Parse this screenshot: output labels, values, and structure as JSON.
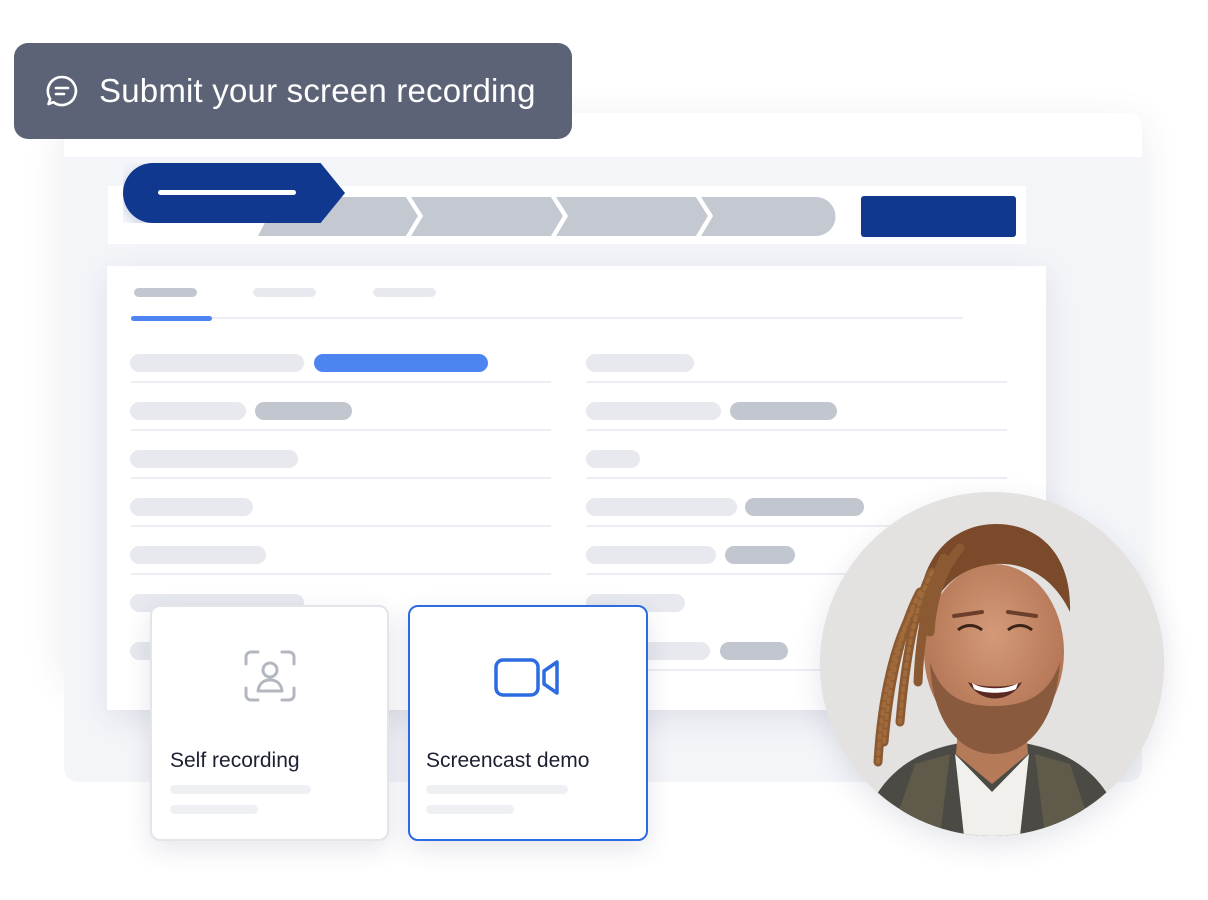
{
  "tooltip": {
    "icon": "chat-bubble-icon",
    "text": "Submit your screen recording"
  },
  "stepper": {
    "steps_total": 5,
    "active_step": 1
  },
  "form": {
    "tabs_count": 3,
    "active_tab": 1
  },
  "options": [
    {
      "icon": "self-recording-icon",
      "label": "Self recording",
      "selected": false
    },
    {
      "icon": "video-camera-icon",
      "label": "Screencast demo",
      "selected": true
    }
  ],
  "colors": {
    "tooltip_bg": "#5d6377",
    "primary": "#11388f",
    "accent_blue": "#2c6be0",
    "highlight_field": "#4d85f0",
    "placeholder_light": "#e7e9ef",
    "placeholder_dark": "#c2c6cf"
  }
}
